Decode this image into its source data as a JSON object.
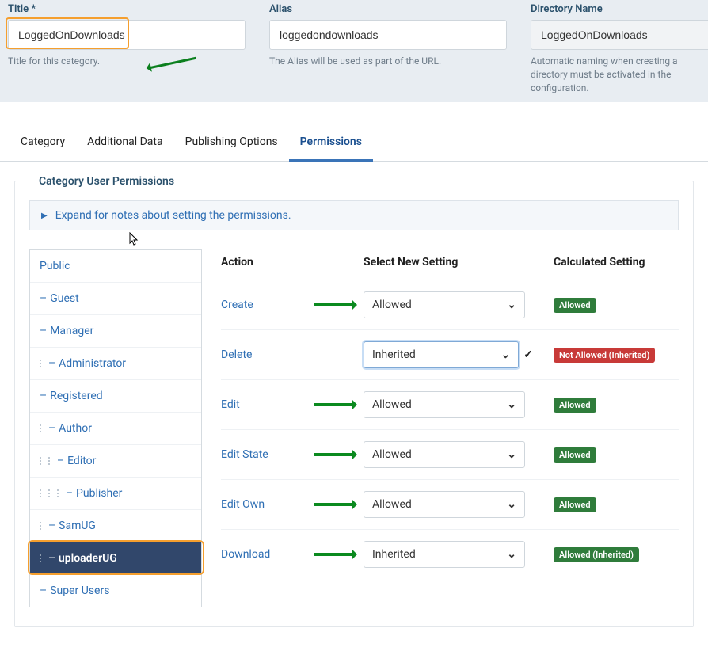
{
  "fields": {
    "title": {
      "label": "Title",
      "required": "*",
      "value": "LoggedOnDownloads",
      "help": "Title for this category."
    },
    "alias": {
      "label": "Alias",
      "value": "loggedondownloads",
      "help": "The Alias will be used as part of the URL."
    },
    "directory": {
      "label": "Directory Name",
      "value": "LoggedOnDownloads",
      "help": "Automatic naming when creating a directory must be activated in the configuration."
    }
  },
  "tabs": {
    "category": "Category",
    "additional": "Additional Data",
    "publishing": "Publishing Options",
    "permissions": "Permissions"
  },
  "permissions": {
    "section_title": "Category User Permissions",
    "expand_note": "Expand for notes about setting the permissions.",
    "groups": [
      {
        "label": "Public",
        "depth": 0
      },
      {
        "label": "Guest",
        "depth": 1
      },
      {
        "label": "Manager",
        "depth": 1
      },
      {
        "label": "Administrator",
        "depth": 2
      },
      {
        "label": "Registered",
        "depth": 1
      },
      {
        "label": "Author",
        "depth": 2
      },
      {
        "label": "Editor",
        "depth": 3
      },
      {
        "label": "Publisher",
        "depth": 4
      },
      {
        "label": "SamUG",
        "depth": 2
      },
      {
        "label": "uploaderUG",
        "depth": 2,
        "selected": true
      },
      {
        "label": "Super Users",
        "depth": 1
      }
    ],
    "columns": {
      "action": "Action",
      "setting": "Select New Setting",
      "calc": "Calculated Setting"
    },
    "rows": [
      {
        "action": "Create",
        "setting": "Allowed",
        "arrow": true,
        "calc": "Allowed",
        "calc_color": "green"
      },
      {
        "action": "Delete",
        "setting": "Inherited",
        "focused": true,
        "check": true,
        "calc": "Not Allowed (Inherited)",
        "calc_color": "red"
      },
      {
        "action": "Edit",
        "setting": "Allowed",
        "arrow": true,
        "calc": "Allowed",
        "calc_color": "green"
      },
      {
        "action": "Edit State",
        "setting": "Allowed",
        "arrow": true,
        "calc": "Allowed",
        "calc_color": "green"
      },
      {
        "action": "Edit Own",
        "setting": "Allowed",
        "arrow": true,
        "calc": "Allowed",
        "calc_color": "green"
      },
      {
        "action": "Download",
        "setting": "Inherited",
        "arrow": true,
        "calc": "Allowed (Inherited)",
        "calc_color": "green"
      }
    ]
  }
}
